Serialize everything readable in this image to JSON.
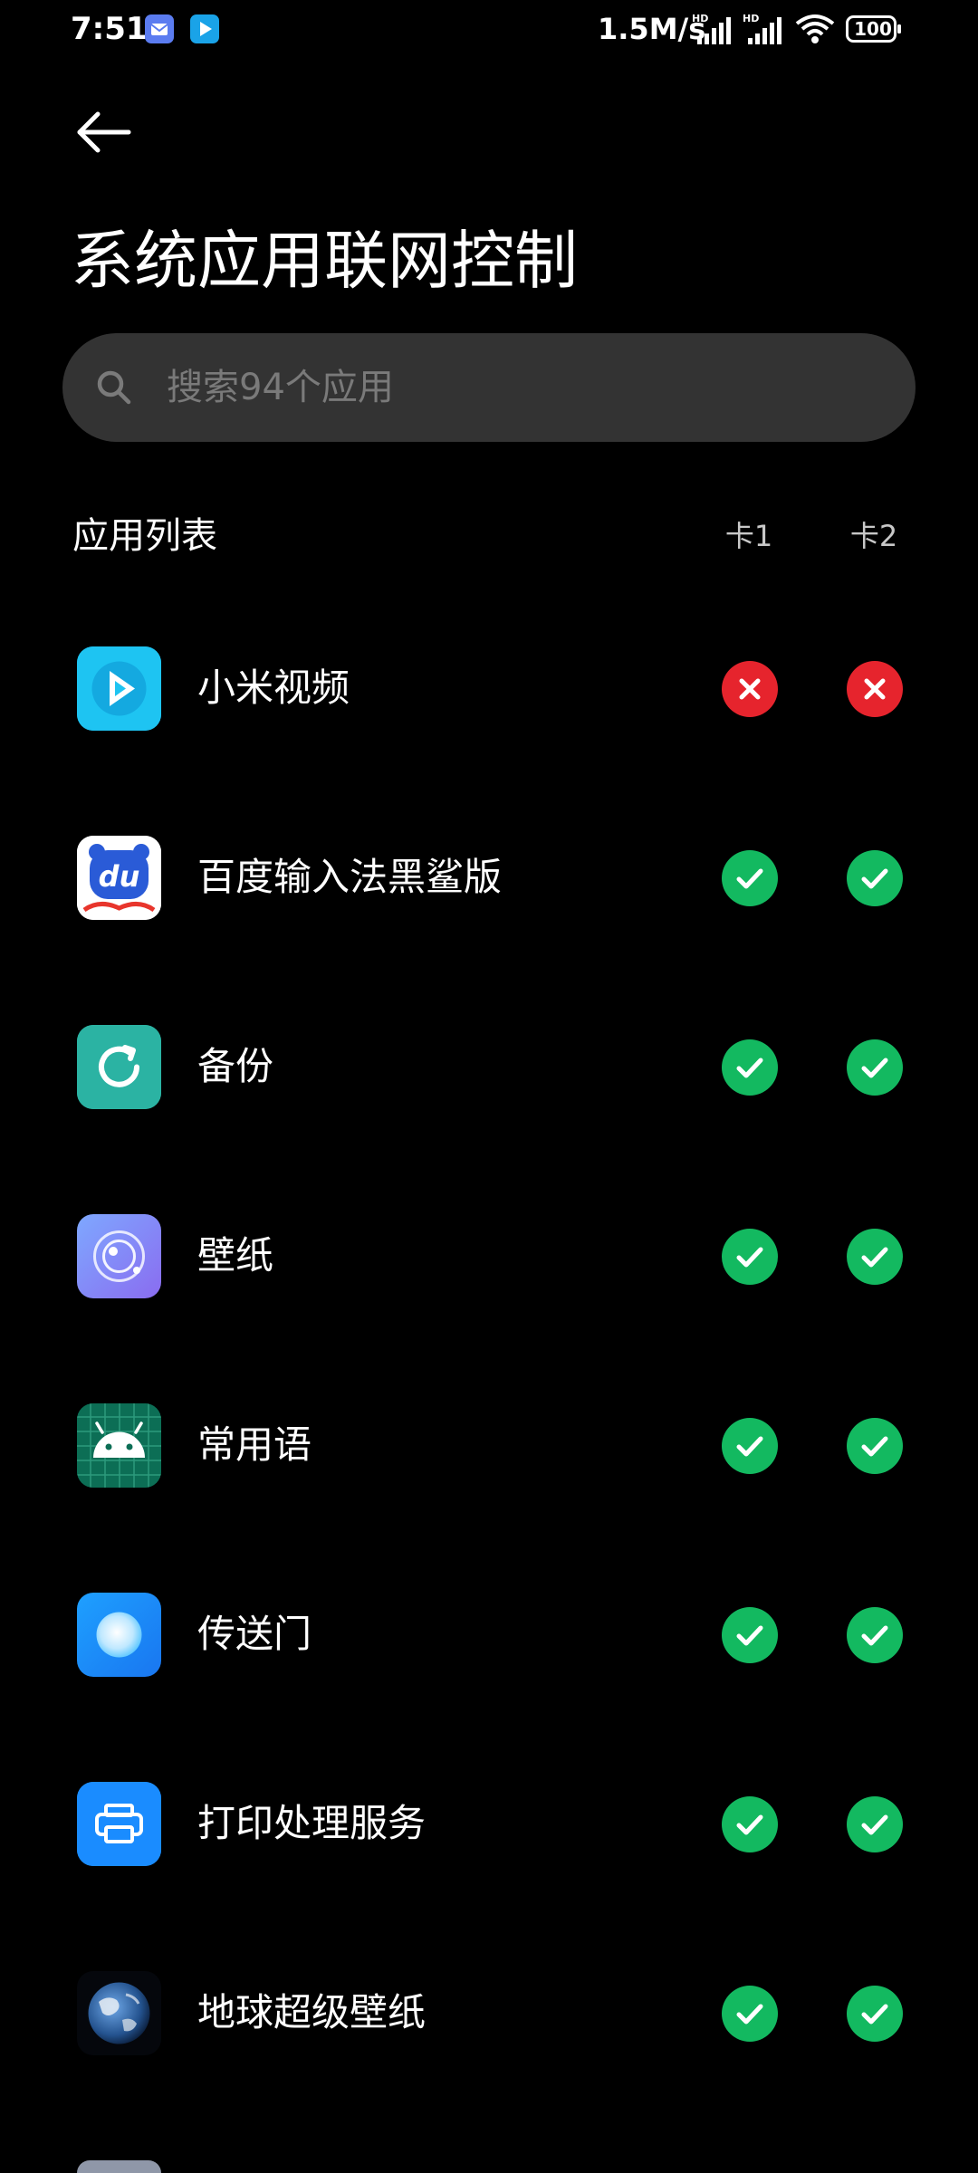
{
  "status_bar": {
    "time": "7:51",
    "speed": "1.5M/s",
    "battery": "100",
    "icons": [
      "mail-notification-icon",
      "video-notification-icon",
      "signal-hd-icon",
      "signal-hd-icon",
      "wifi-icon",
      "battery-icon"
    ]
  },
  "header": {
    "back_icon": "arrow-left-icon",
    "title": "系统应用联网控制"
  },
  "search": {
    "placeholder": "搜索94个应用",
    "value": ""
  },
  "list": {
    "title": "应用列表",
    "columns": [
      "卡1",
      "卡2"
    ],
    "apps": [
      {
        "name": "小米视频",
        "icon": "mi-video-icon",
        "sim1": false,
        "sim2": false
      },
      {
        "name": "百度输入法黑鲨版",
        "icon": "baidu-ime-icon",
        "sim1": true,
        "sim2": true
      },
      {
        "name": "备份",
        "icon": "backup-icon",
        "sim1": true,
        "sim2": true
      },
      {
        "name": "壁纸",
        "icon": "wallpaper-icon",
        "sim1": true,
        "sim2": true
      },
      {
        "name": "常用语",
        "icon": "android-icon",
        "sim1": true,
        "sim2": true
      },
      {
        "name": "传送门",
        "icon": "portal-icon",
        "sim1": true,
        "sim2": true
      },
      {
        "name": "打印处理服务",
        "icon": "printer-icon",
        "sim1": true,
        "sim2": true
      },
      {
        "name": "地球超级壁纸",
        "icon": "earth-icon",
        "sim1": true,
        "sim2": true
      }
    ]
  },
  "colors": {
    "background": "#000000",
    "search_bg": "#333333",
    "toggle_on": "#13b960",
    "toggle_off": "#e6242d",
    "text": "#ffffff",
    "placeholder": "#7a7a7a"
  }
}
